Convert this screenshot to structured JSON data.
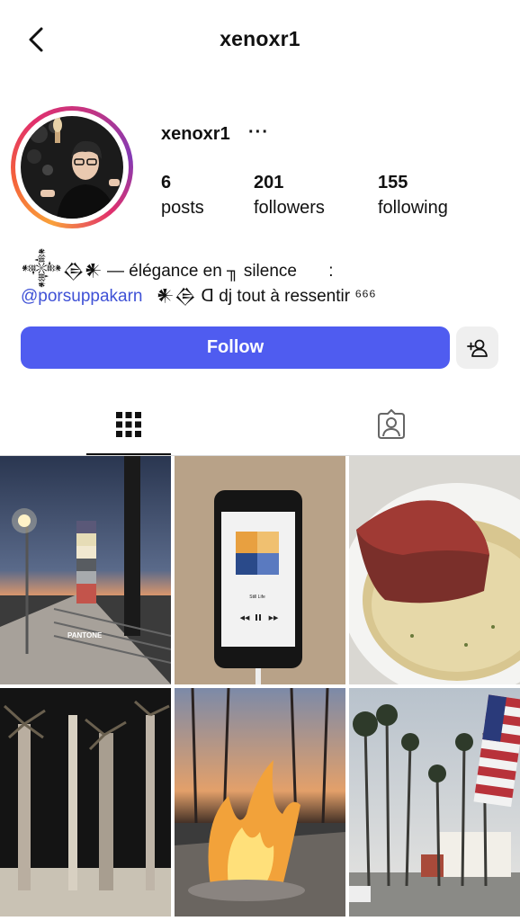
{
  "header": {
    "title": "xenoxr1",
    "back_icon": "chevron-left-icon"
  },
  "profile": {
    "username": "xenoxr1",
    "more_label": "···",
    "stats": [
      {
        "value": "6",
        "label": "posts"
      },
      {
        "value": "201",
        "label": "followers"
      },
      {
        "value": "155",
        "label": "following"
      }
    ],
    "bio": {
      "line1_glyphs": "𒀱𒁲𒀭",
      "line1_text": " — élégance en ╖ silence",
      "line1_tail": ":",
      "mention": "@porsuppakarn",
      "line2_glyphs": "𒀭𒁲 ꓷ",
      "line2_text": " dj tout à ressentir ⁶⁶⁶"
    }
  },
  "actions": {
    "follow_label": "Follow",
    "follow_color": "#4f5cf0",
    "suggest_icon": "add-person-icon"
  },
  "tabs": {
    "grid_icon": "grid-icon",
    "tagged_icon": "tagged-user-icon"
  },
  "posts": [
    {
      "id": "post-1",
      "scene": "night walkway with street lamp and color swatch",
      "caption_text": "PANTONE"
    },
    {
      "id": "post-2",
      "scene": "phone showing music player",
      "track": "Still Life"
    },
    {
      "id": "post-3",
      "scene": "steak on a plate"
    },
    {
      "id": "post-4",
      "scene": "palm trees at night"
    },
    {
      "id": "post-5",
      "scene": "fire pit at dusk"
    },
    {
      "id": "post-6",
      "scene": "palm trees and american flag"
    }
  ]
}
